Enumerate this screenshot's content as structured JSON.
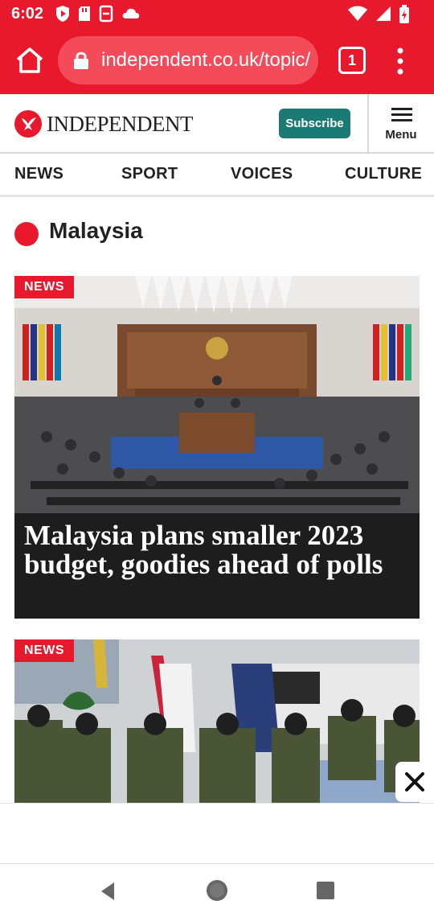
{
  "status_bar": {
    "time": "6:02"
  },
  "browser": {
    "url": "independent.co.uk/topic/malaysia",
    "tab_count": "1"
  },
  "site": {
    "logo_text": "INDEPENDENT",
    "subscribe_label": "Subscribe",
    "menu_label": "Menu"
  },
  "nav": {
    "items": [
      "NEWS",
      "SPORT",
      "VOICES",
      "CULTURE"
    ]
  },
  "section": {
    "title": "Malaysia"
  },
  "articles": [
    {
      "tag": "NEWS",
      "headline": "Malaysia plans smaller 2023 budget, goodies ahead of polls"
    },
    {
      "tag": "NEWS",
      "headline": ""
    }
  ],
  "colors": {
    "brand_red": "#e8192c",
    "subscribe_teal": "#1b7a73",
    "headline_bg": "#1d1d1d"
  },
  "icons": [
    "home-icon",
    "lock-icon",
    "tabs-icon",
    "more-vert-icon",
    "hamburger-icon",
    "close-icon",
    "back-icon",
    "home-nav-icon",
    "recents-icon"
  ]
}
